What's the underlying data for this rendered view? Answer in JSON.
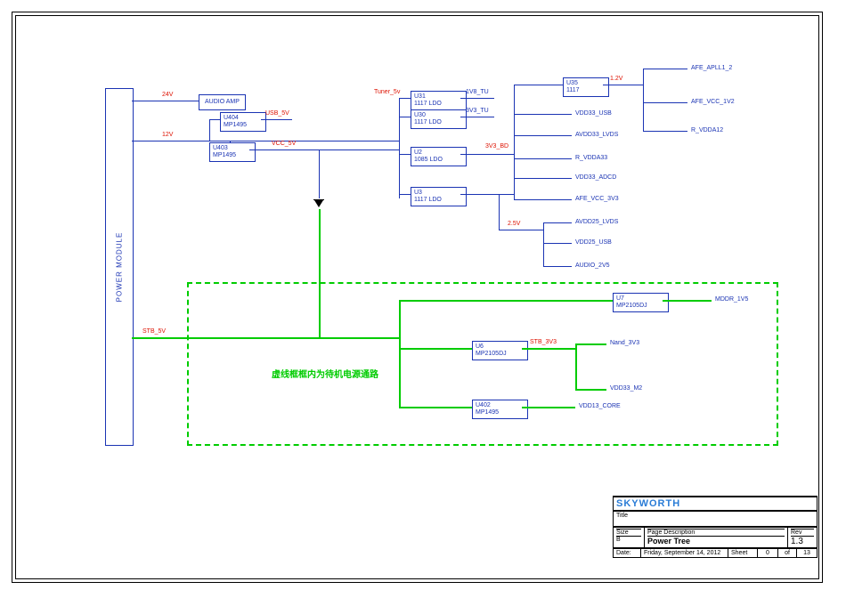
{
  "power_module": "POWER MODULE",
  "rails": {
    "v24": "24V",
    "v12": "12V",
    "stb_5v": "STB_5V",
    "usb_5v": "USB_5V",
    "vcc_5v": "VCC_5V",
    "tuner_5v": "Tuner_5v",
    "v1_2": "1.2V",
    "v2_5": "2.5V",
    "stb_3v3": "STB_3V3",
    "v1v8_tu": "1V8_TU",
    "v3v3_tu": "3V3_TU",
    "v3v3_bd": "3V3_BD"
  },
  "nets": {
    "afe_apll1_2": "AFE_APLL1_2",
    "afe_vcc_1v2": "AFE_VCC_1V2",
    "r_vdda12": "R_VDDA12",
    "vdd33_usb": "VDD33_USB",
    "avdd33_lvds": "AVDD33_LVDS",
    "r_vdda33": "R_VDDA33",
    "vdd33_adcd": "VDD33_ADCD",
    "afe_vcc_3v3": "AFE_VCC_3V3",
    "avdd25_lvds": "AVDD25_LVDS",
    "vdd25_usb": "VDD25_USB",
    "audio_2v5": "AUDIO_2V5",
    "mddr_1v5": "MDDR_1V5",
    "nand_3v3": "Nand_3V3",
    "vdd33_m2": "VDD33_M2",
    "vdd13_core": "VDD13_CORE"
  },
  "blocks": {
    "audio_amp": "AUDIO AMP",
    "u404": {
      "ref": "U404",
      "val": "MP1495"
    },
    "u403": {
      "ref": "U403",
      "val": "MP1495"
    },
    "u31": {
      "ref": "U31",
      "val": "1117 LDO"
    },
    "u30": {
      "ref": "U30",
      "val": "1117 LDO"
    },
    "u2": {
      "ref": "U2",
      "val": "1085 LDO"
    },
    "u3": {
      "ref": "U3",
      "val": "1117 LDO"
    },
    "u35": {
      "ref": "U35",
      "val": "1117"
    },
    "u7": {
      "ref": "U7",
      "val": "MP2105DJ"
    },
    "u6": {
      "ref": "U6",
      "val": "MP2105DJ"
    },
    "u402": {
      "ref": "U402",
      "val": "MP1495"
    }
  },
  "note": "虚线框框内为待机电源通路",
  "titleblock": {
    "logo": "SKYWORTH",
    "title_label": "Title",
    "size_label": "Size",
    "size": "B",
    "page_desc_label": "Page Description",
    "page_desc": "Power Tree",
    "rev_label": "Rev",
    "rev": "1.3",
    "date_label": "Date:",
    "date": "Friday, September 14, 2012",
    "sheet_label": "Sheet",
    "sheet_cur": "0",
    "sheet_of": "of",
    "sheet_tot": "13"
  }
}
